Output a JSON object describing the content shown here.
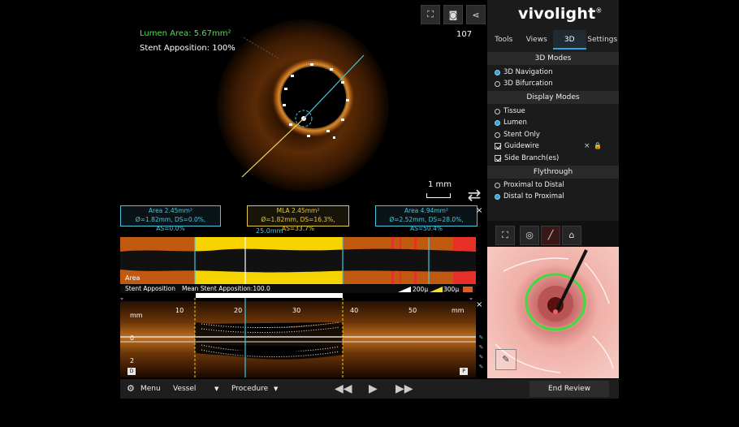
{
  "cross_section": {
    "lumen_area": "Lumen Area: 5.67mm²",
    "stent_apposition": "Stent Apposition: 100%",
    "frame_number": "107",
    "scale_label": "1 mm",
    "icons": [
      "fullscreen-icon",
      "camera-icon",
      "share-icon",
      "swap-view-icon"
    ]
  },
  "brand": {
    "name": "vivolight",
    "mark": "®"
  },
  "tabs": [
    {
      "label": "Tools",
      "active": false
    },
    {
      "label": "Views",
      "active": false
    },
    {
      "label": "3D",
      "active": true
    },
    {
      "label": "Settings",
      "active": false
    }
  ],
  "modes_3d": {
    "title": "3D Modes",
    "options": [
      {
        "label": "3D Navigation",
        "selected": true
      },
      {
        "label": "3D Bifurcation",
        "selected": false
      }
    ]
  },
  "display_modes": {
    "title": "Display Modes",
    "radios": [
      {
        "label": "Tissue",
        "selected": false
      },
      {
        "label": "Lumen",
        "selected": true
      },
      {
        "label": "Stent Only",
        "selected": false
      }
    ],
    "checks": [
      {
        "label": "Guidewire",
        "checked": true
      },
      {
        "label": "Side Branch(es)",
        "checked": true
      }
    ],
    "guidewire_close": "×",
    "guidewire_lock": "🔒"
  },
  "flythrough": {
    "title": "Flythrough",
    "options": [
      {
        "label": "Proximal to Distal",
        "selected": false
      },
      {
        "label": "Distal to Proximal",
        "selected": true
      }
    ]
  },
  "measurements": {
    "left": {
      "line1": "Area 2.45mm²",
      "line2": "Ø=1.82mm, DS=0.0%, AS=0.0%"
    },
    "mla": {
      "line1": "MLA 2.45mm²",
      "line2": "Ø=1.82mm, DS=16.3%, AS=33.7%"
    },
    "right": {
      "line1": "Area 4.94mm²",
      "line2": "Ø=2.52mm, DS=28.0%, AS=50.4%"
    },
    "length": "25.0mm",
    "close": "×"
  },
  "area_track": {
    "label": "Area"
  },
  "apposition_bar": {
    "label": "Stent Apposition",
    "mean": "Mean Stent Apposition:100.0",
    "mean_fraction": 1.0,
    "legend": [
      "200μ",
      "300μ"
    ],
    "legend_colors": [
      "#ffffff",
      "#f0e030",
      "#e85b1a"
    ]
  },
  "longitudinal": {
    "axis_unit": "mm",
    "ticks": [
      "10",
      "20",
      "30",
      "40",
      "50"
    ],
    "depth_ticks": [
      "0",
      "2"
    ],
    "distal_marker": "D",
    "proximal_marker": "P",
    "close": "×"
  },
  "bottom_bar": {
    "menu": "Menu",
    "vessel": "Vessel",
    "procedure": "Procedure",
    "end_review": "End Review",
    "rewind": "◀◀",
    "play": "▶",
    "forward": "▶▶"
  },
  "colors": {
    "accent_blue": "#2aa7e0",
    "cyan_measure": "#47c6de",
    "mla_yellow": "#e5c93a",
    "lumen_green": "#4be24b",
    "highlight_yellow": "#f7d400"
  }
}
